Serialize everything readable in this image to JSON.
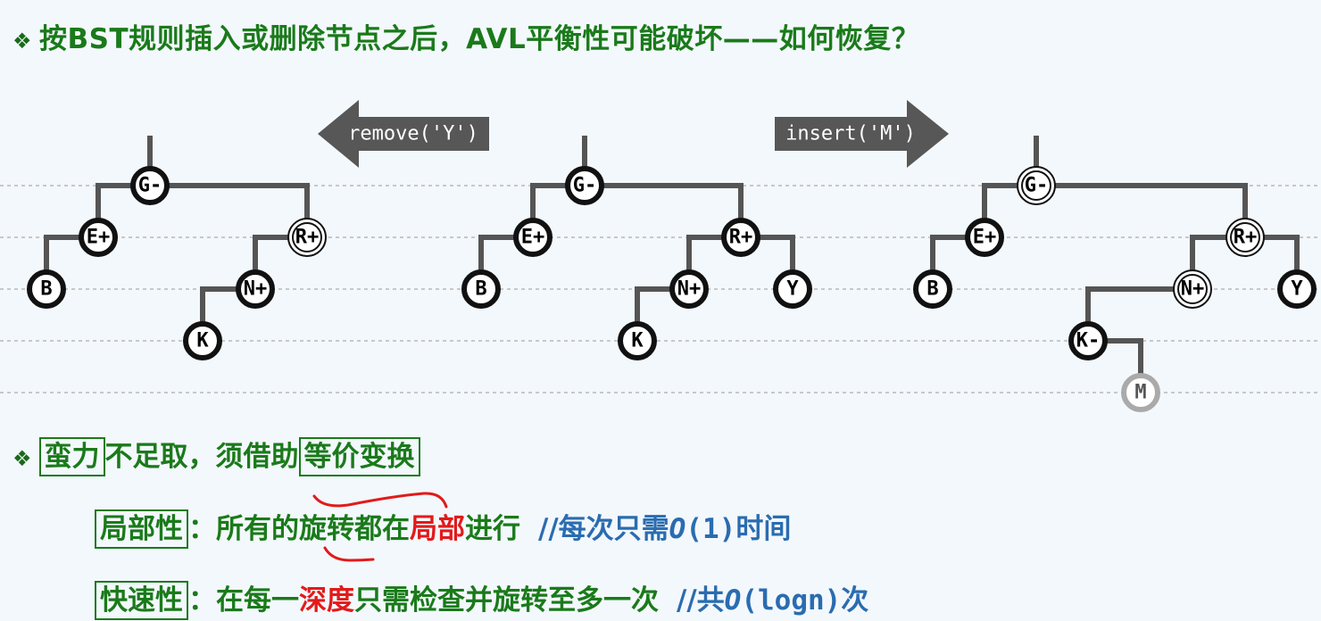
{
  "title": {
    "bullet": "❖",
    "text": "按BST规则插入或删除节点之后，AVL平衡性可能破坏——如何恢复？"
  },
  "operations": {
    "remove": "remove('Y')",
    "insert": "insert('M')"
  },
  "trees": {
    "left": [
      "G-",
      "E+",
      "R+",
      "B",
      "N+",
      "K"
    ],
    "middle": [
      "G-",
      "E+",
      "R+",
      "B",
      "N+",
      "Y",
      "K"
    ],
    "right": [
      "G-",
      "E+",
      "R+",
      "B",
      "N+",
      "Y",
      "K-",
      "M"
    ]
  },
  "point1": {
    "bullet": "❖",
    "term1": "蛮力",
    "middle": "不足取，须借助",
    "term2": "等价变换"
  },
  "point2": {
    "term": "局部性",
    "colon": "：",
    "text_a": "所有的旋转都在",
    "text_red": "局部",
    "text_b": "进行",
    "comment_a": "//每次只需",
    "comment_o": "O",
    "comment_b": "(1)时间"
  },
  "point3": {
    "term": "快速性",
    "colon": "：",
    "text_a": "在每一",
    "text_red": "深度",
    "text_b": "只需检查并旋转至多一次",
    "comment_a": "//共",
    "comment_o": "O",
    "comment_b": "(logn)次"
  }
}
